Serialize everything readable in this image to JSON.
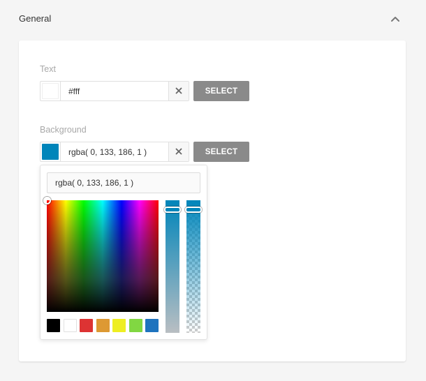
{
  "section": {
    "title": "General",
    "toggle_icon": "chevron-up-icon"
  },
  "text_field": {
    "label": "Text",
    "value": "#fff",
    "swatch_color": "#ffffff",
    "clear_icon": "close-icon",
    "select_label": "SELECT"
  },
  "background_field": {
    "label": "Background",
    "value": "rgba( 0, 133, 186, 1 )",
    "swatch_color": "#0085ba",
    "clear_icon": "close-icon",
    "select_label": "SELECT"
  },
  "picker": {
    "input_value": "rgba( 0, 133, 186, 1 )",
    "hue_color": "#0085ba",
    "alpha": 1,
    "palette": [
      "#000000",
      "#ffffff",
      "#dd3333",
      "#dd9933",
      "#eeee22",
      "#81d742",
      "#1e73be"
    ]
  }
}
